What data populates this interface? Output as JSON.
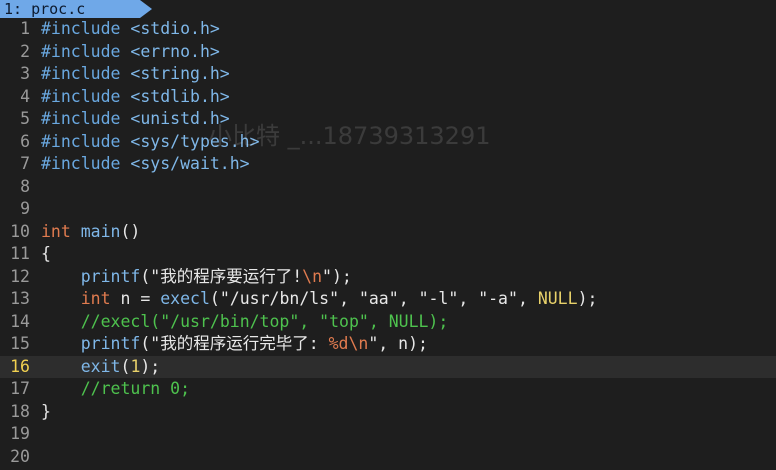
{
  "tab": {
    "label": "1: proc.c"
  },
  "watermark": "小比特 _...18739313291",
  "colors": {
    "background": "#1e1e1e",
    "tab": "#6fa8e8",
    "keyword": "#e07b4f",
    "function": "#7fb7e8",
    "comment": "#4ec24e",
    "constant": "#e8d16a"
  },
  "lines": [
    {
      "n": "1",
      "t": [
        [
          "pp",
          "#include "
        ],
        [
          "hdr",
          "<stdio.h>"
        ]
      ]
    },
    {
      "n": "2",
      "t": [
        [
          "pp",
          "#include "
        ],
        [
          "hdr",
          "<errno.h>"
        ]
      ]
    },
    {
      "n": "3",
      "t": [
        [
          "pp",
          "#include "
        ],
        [
          "hdr",
          "<string.h>"
        ]
      ]
    },
    {
      "n": "4",
      "t": [
        [
          "pp",
          "#include "
        ],
        [
          "hdr",
          "<stdlib.h>"
        ]
      ]
    },
    {
      "n": "5",
      "t": [
        [
          "pp",
          "#include "
        ],
        [
          "hdr",
          "<unistd.h>"
        ]
      ]
    },
    {
      "n": "6",
      "t": [
        [
          "pp",
          "#include "
        ],
        [
          "hdr",
          "<sys/types.h>"
        ]
      ]
    },
    {
      "n": "7",
      "t": [
        [
          "pp",
          "#include "
        ],
        [
          "hdr",
          "<sys/wait.h>"
        ]
      ]
    },
    {
      "n": "8",
      "t": []
    },
    {
      "n": "9",
      "t": []
    },
    {
      "n": "10",
      "t": [
        [
          "kw",
          "int"
        ],
        [
          "punc",
          " "
        ],
        [
          "fn",
          "main"
        ],
        [
          "punc",
          "()"
        ]
      ]
    },
    {
      "n": "11",
      "t": [
        [
          "punc",
          "{"
        ]
      ]
    },
    {
      "n": "12",
      "t": [
        [
          "punc",
          "    "
        ],
        [
          "fn",
          "printf"
        ],
        [
          "punc",
          "("
        ],
        [
          "str",
          "\"我的程序要运行了!"
        ],
        [
          "esc",
          "\\n"
        ],
        [
          "str",
          "\""
        ],
        [
          "punc",
          ");"
        ]
      ]
    },
    {
      "n": "13",
      "t": [
        [
          "punc",
          "    "
        ],
        [
          "kw",
          "int"
        ],
        [
          "punc",
          " n = "
        ],
        [
          "fn",
          "execl"
        ],
        [
          "punc",
          "("
        ],
        [
          "str",
          "\"/usr/bn/ls\""
        ],
        [
          "punc",
          ", "
        ],
        [
          "str",
          "\"aa\""
        ],
        [
          "punc",
          ", "
        ],
        [
          "str",
          "\"-l\""
        ],
        [
          "punc",
          ", "
        ],
        [
          "str",
          "\"-a\""
        ],
        [
          "punc",
          ", "
        ],
        [
          "null",
          "NULL"
        ],
        [
          "punc",
          ");"
        ]
      ]
    },
    {
      "n": "14",
      "t": [
        [
          "punc",
          "    "
        ],
        [
          "cmt",
          "//execl(\"/usr/bin/top\", \"top\", NULL);"
        ]
      ]
    },
    {
      "n": "15",
      "t": [
        [
          "punc",
          "    "
        ],
        [
          "fn",
          "printf"
        ],
        [
          "punc",
          "("
        ],
        [
          "str",
          "\"我的程序运行完毕了: "
        ],
        [
          "esc",
          "%d\\n"
        ],
        [
          "str",
          "\""
        ],
        [
          "punc",
          ", n);"
        ]
      ]
    },
    {
      "n": "16",
      "current": true,
      "t": [
        [
          "punc",
          "    "
        ],
        [
          "fn",
          "exit"
        ],
        [
          "punc",
          "("
        ],
        [
          "num",
          "1"
        ],
        [
          "punc",
          ");"
        ]
      ]
    },
    {
      "n": "17",
      "t": [
        [
          "punc",
          "    "
        ],
        [
          "cmt",
          "//return 0;"
        ]
      ]
    },
    {
      "n": "18",
      "t": [
        [
          "punc",
          "}"
        ]
      ]
    },
    {
      "n": "19",
      "t": []
    },
    {
      "n": "20",
      "t": []
    }
  ]
}
